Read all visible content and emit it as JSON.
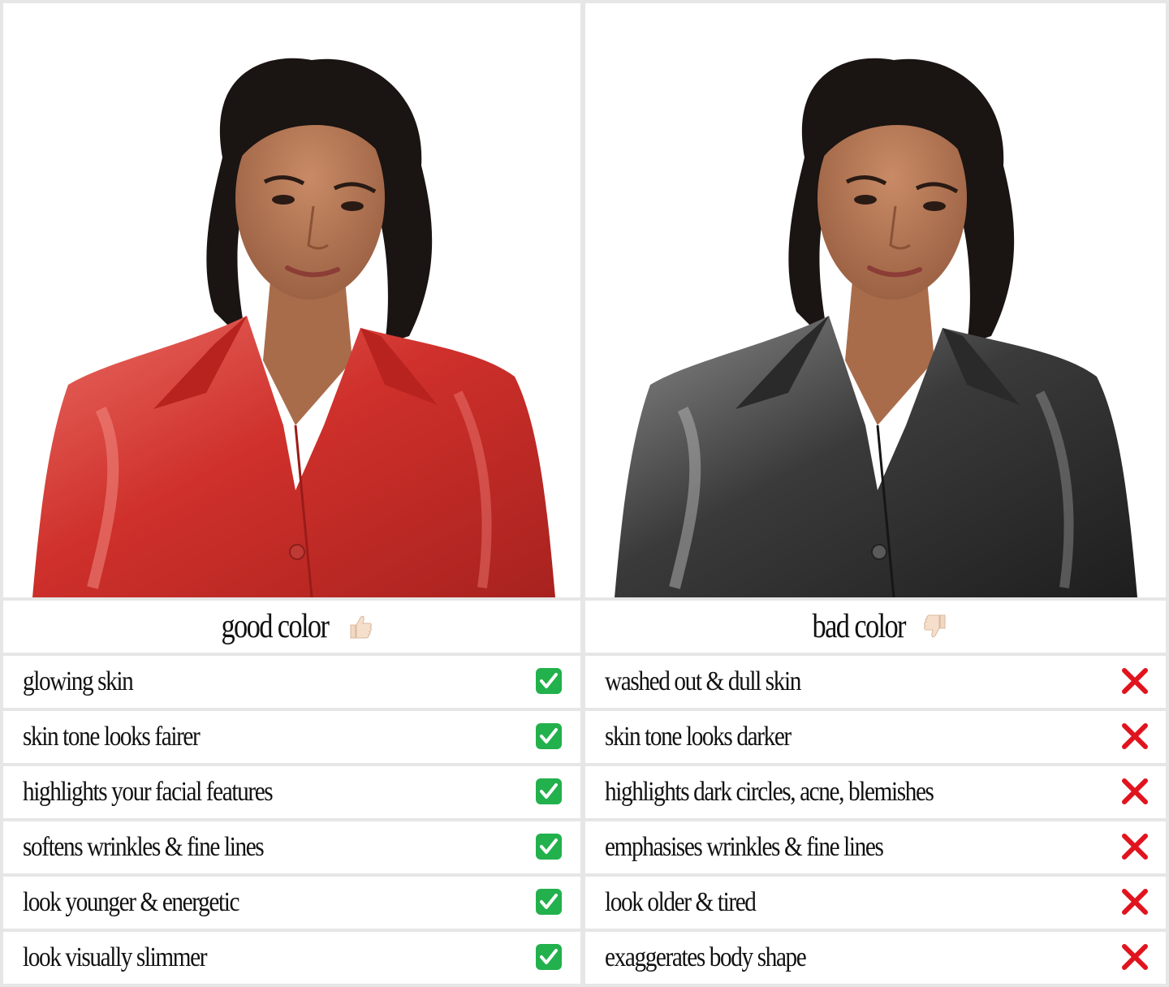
{
  "good": {
    "title": "good color",
    "icon": "thumbs-up-icon",
    "mark_icon": "check-box-icon",
    "shirt_color": "#d8433f",
    "items": [
      "glowing skin",
      "skin tone looks fairer",
      "highlights your facial features",
      "softens wrinkles & fine lines",
      "look younger & energetic",
      "look visually slimmer"
    ]
  },
  "bad": {
    "title": "bad color",
    "icon": "thumbs-down-icon",
    "mark_icon": "cross-mark-icon",
    "shirt_color": "#4a4a4a",
    "items": [
      "washed out & dull skin",
      "skin tone looks darker",
      "highlights dark circles, acne, blemishes",
      "emphasises wrinkles & fine lines",
      "look older & tired",
      "exaggerates body shape"
    ]
  },
  "colors": {
    "check_green": "#22b14c",
    "cross_red": "#e0141e",
    "skin": "#b97a58",
    "hair": "#1a1412"
  }
}
